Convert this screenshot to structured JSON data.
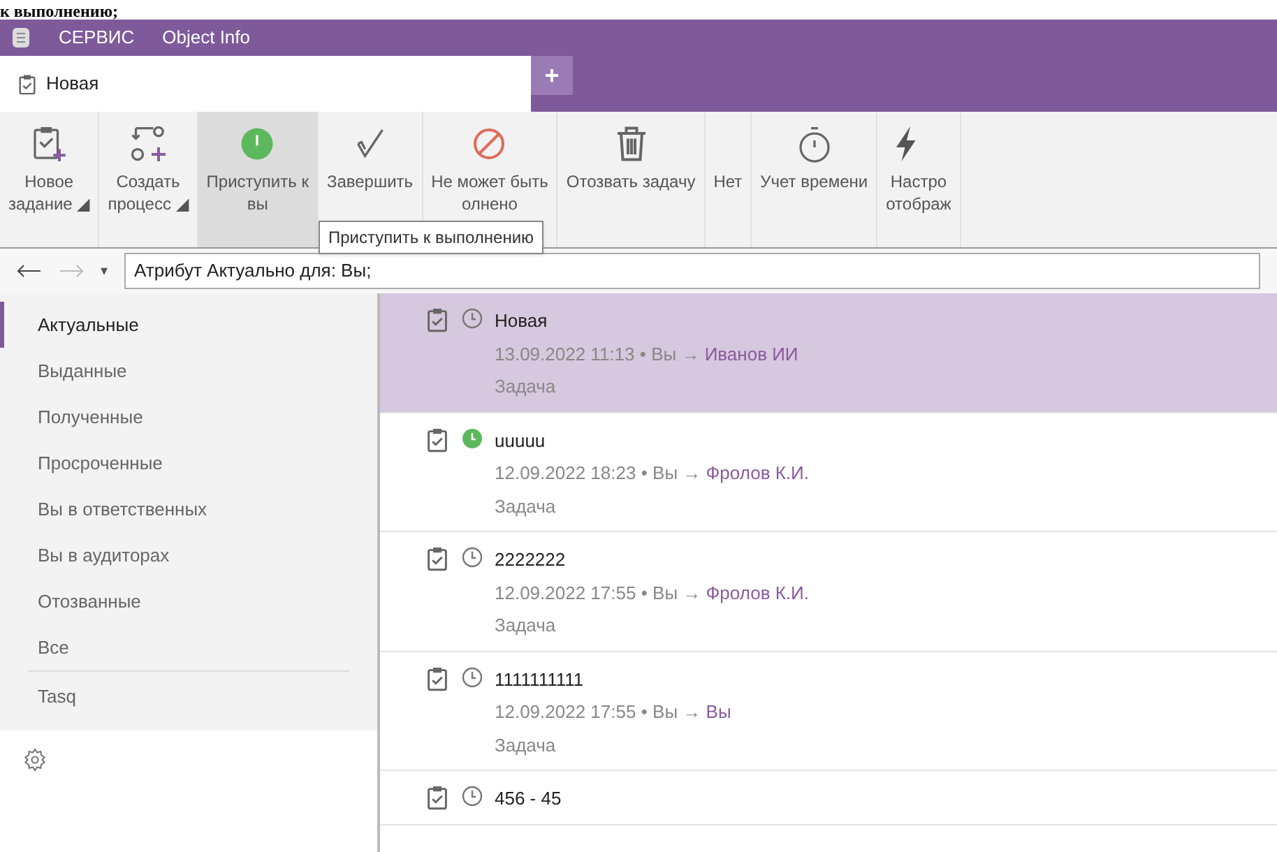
{
  "document_heading": "к выполнению;",
  "title_bar": {
    "menu": [
      "СЕРВИС",
      "Object Info"
    ]
  },
  "tabs": [
    {
      "label": "Новая",
      "selected": true
    }
  ],
  "add_tab": "+",
  "ribbon": [
    {
      "kind": "new-task",
      "lines": [
        "Новое",
        "задание ◢"
      ],
      "selected": false
    },
    {
      "kind": "process",
      "lines": [
        "Создать",
        "процесс ◢"
      ],
      "selected": false
    },
    {
      "kind": "start",
      "lines": [
        "Приступить к",
        "вы"
      ],
      "selected": true
    },
    {
      "kind": "done",
      "lines": [
        "Завершить"
      ],
      "selected": false
    },
    {
      "kind": "cannot",
      "lines": [
        "Не может быть",
        "олнено"
      ],
      "selected": false
    },
    {
      "kind": "recall",
      "lines": [
        "Отозвать задачу"
      ],
      "selected": false
    },
    {
      "kind": "none",
      "lines": [
        "Нет"
      ],
      "selected": false
    },
    {
      "kind": "timer",
      "lines": [
        "Учет времени"
      ],
      "selected": false
    },
    {
      "kind": "bolt",
      "lines": [
        "Настро",
        "отображ"
      ],
      "selected": false
    }
  ],
  "tooltip": "Приступить к выполнению",
  "address": {
    "dropdown": "▾",
    "value": "Атрибут Актуально для: Вы;"
  },
  "sidebar": {
    "items": [
      {
        "label": "Актуальные",
        "selected": true
      },
      {
        "label": "Выданные",
        "selected": false
      },
      {
        "label": "Полученные",
        "selected": false
      },
      {
        "label": "Просроченные",
        "selected": false
      },
      {
        "label": "Вы в ответственных",
        "selected": false
      },
      {
        "label": "Вы в аудиторах",
        "selected": false
      },
      {
        "label": "Отозванные",
        "selected": false
      },
      {
        "label": "Все",
        "selected": false
      }
    ],
    "extra": [
      {
        "label": "Tasq",
        "selected": false
      }
    ]
  },
  "tasks": [
    {
      "title": "Новая",
      "date": "13.09.2022 11:13",
      "from": "Вы",
      "separator": "•",
      "arrow": "→",
      "to": "Иванов ИИ",
      "type": "Задача",
      "in_progress": false,
      "selected": true
    },
    {
      "title": "uuuuu",
      "date": "12.09.2022 18:23",
      "from": "Вы",
      "separator": "•",
      "arrow": "→",
      "to": "Фролов К.И.",
      "type": "Задача",
      "in_progress": true,
      "selected": false
    },
    {
      "title": "2222222",
      "date": "12.09.2022 17:55",
      "from": "Вы",
      "separator": "•",
      "arrow": "→",
      "to": "Фролов К.И.",
      "type": "Задача",
      "in_progress": false,
      "selected": false
    },
    {
      "title": "1111111111",
      "date": "12.09.2022 17:55",
      "from": "Вы",
      "separator": "•",
      "arrow": "→",
      "to": "Вы",
      "type": "Задача",
      "in_progress": false,
      "selected": false
    },
    {
      "title": "456 - 45",
      "in_progress": false,
      "selected": false
    }
  ]
}
